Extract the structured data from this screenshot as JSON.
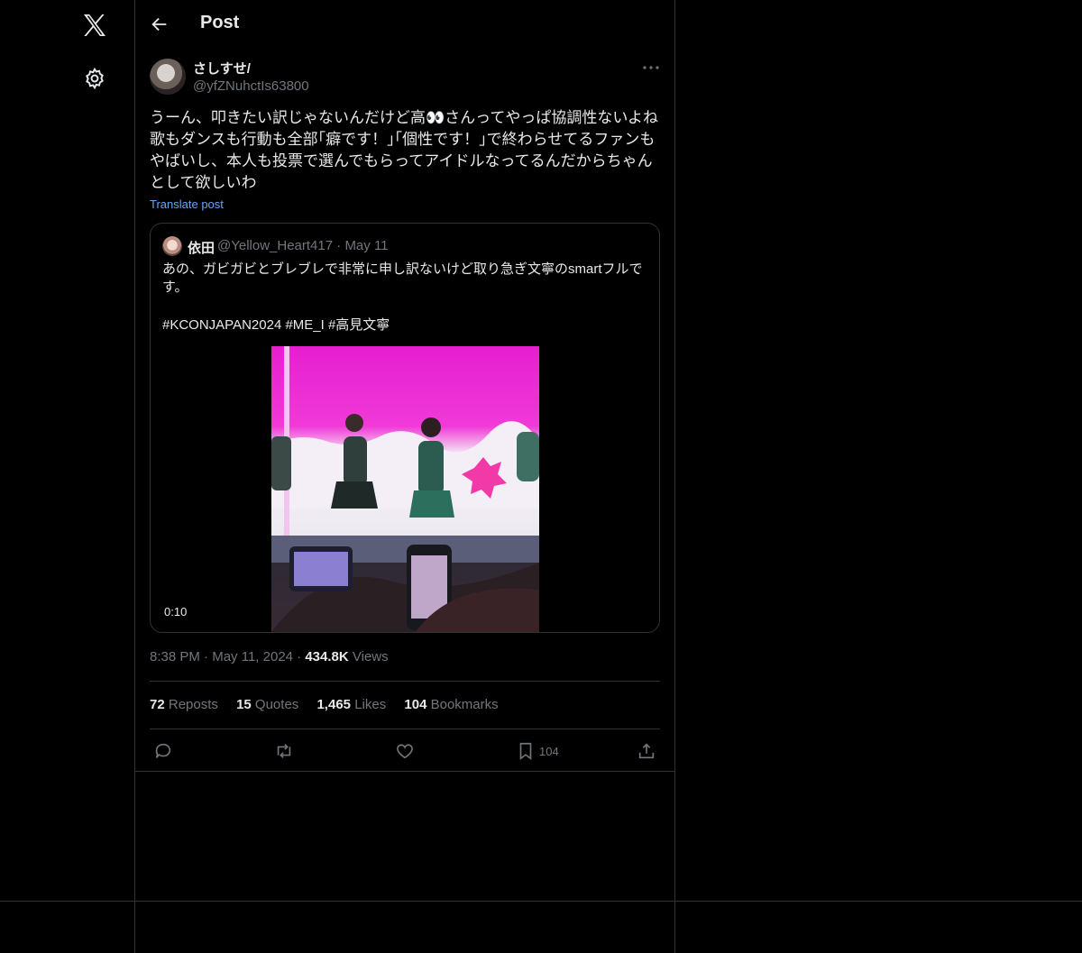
{
  "header": {
    "title": "Post"
  },
  "post": {
    "author": {
      "name": "さしすせ/",
      "handle": "@yfZNuhctIs63800"
    },
    "text": "うーん、叩きたい訳じゃないんだけど高👀さんってやっぱ協調性ないよね\n歌もダンスも行動も全部｢癖です！｣｢個性です！｣で終わらせてるファンも\nやばいし、本人も投票で選んでもらってアイドルなってるんだからちゃん\nとして欲しいわ",
    "translate": "Translate post",
    "quote": {
      "name": "依田",
      "handle": "@Yellow_Heart417",
      "dot": "·",
      "date": "May 11",
      "text": "あの、ガビガビとブレブレで非常に申し訳ないけど取り急ぎ文寧のsmartフルです。",
      "tags": "#KCONJAPAN2024 #ME_I #高見文寧",
      "duration": "0:10"
    },
    "time": "8:38 PM",
    "sep": "·",
    "date": "May 11, 2024",
    "views": "434.8K",
    "views_label": "Views",
    "stats": {
      "reposts": "72",
      "reposts_label": "Reposts",
      "quotes": "15",
      "quotes_label": "Quotes",
      "likes": "1,465",
      "likes_label": "Likes",
      "bookmarks": "104",
      "bookmarks_label": "Bookmarks"
    },
    "bookmark_count": "104"
  },
  "colors": {
    "background": "#000000",
    "text": "#e7e9ea",
    "muted": "#71767b",
    "link": "#6aa5f0",
    "border": "#2f3336"
  },
  "icons": [
    "x-logo-icon",
    "settings-icon",
    "back-arrow-icon",
    "more-icon",
    "reply-icon",
    "repost-icon",
    "like-icon",
    "bookmark-icon",
    "share-icon"
  ]
}
